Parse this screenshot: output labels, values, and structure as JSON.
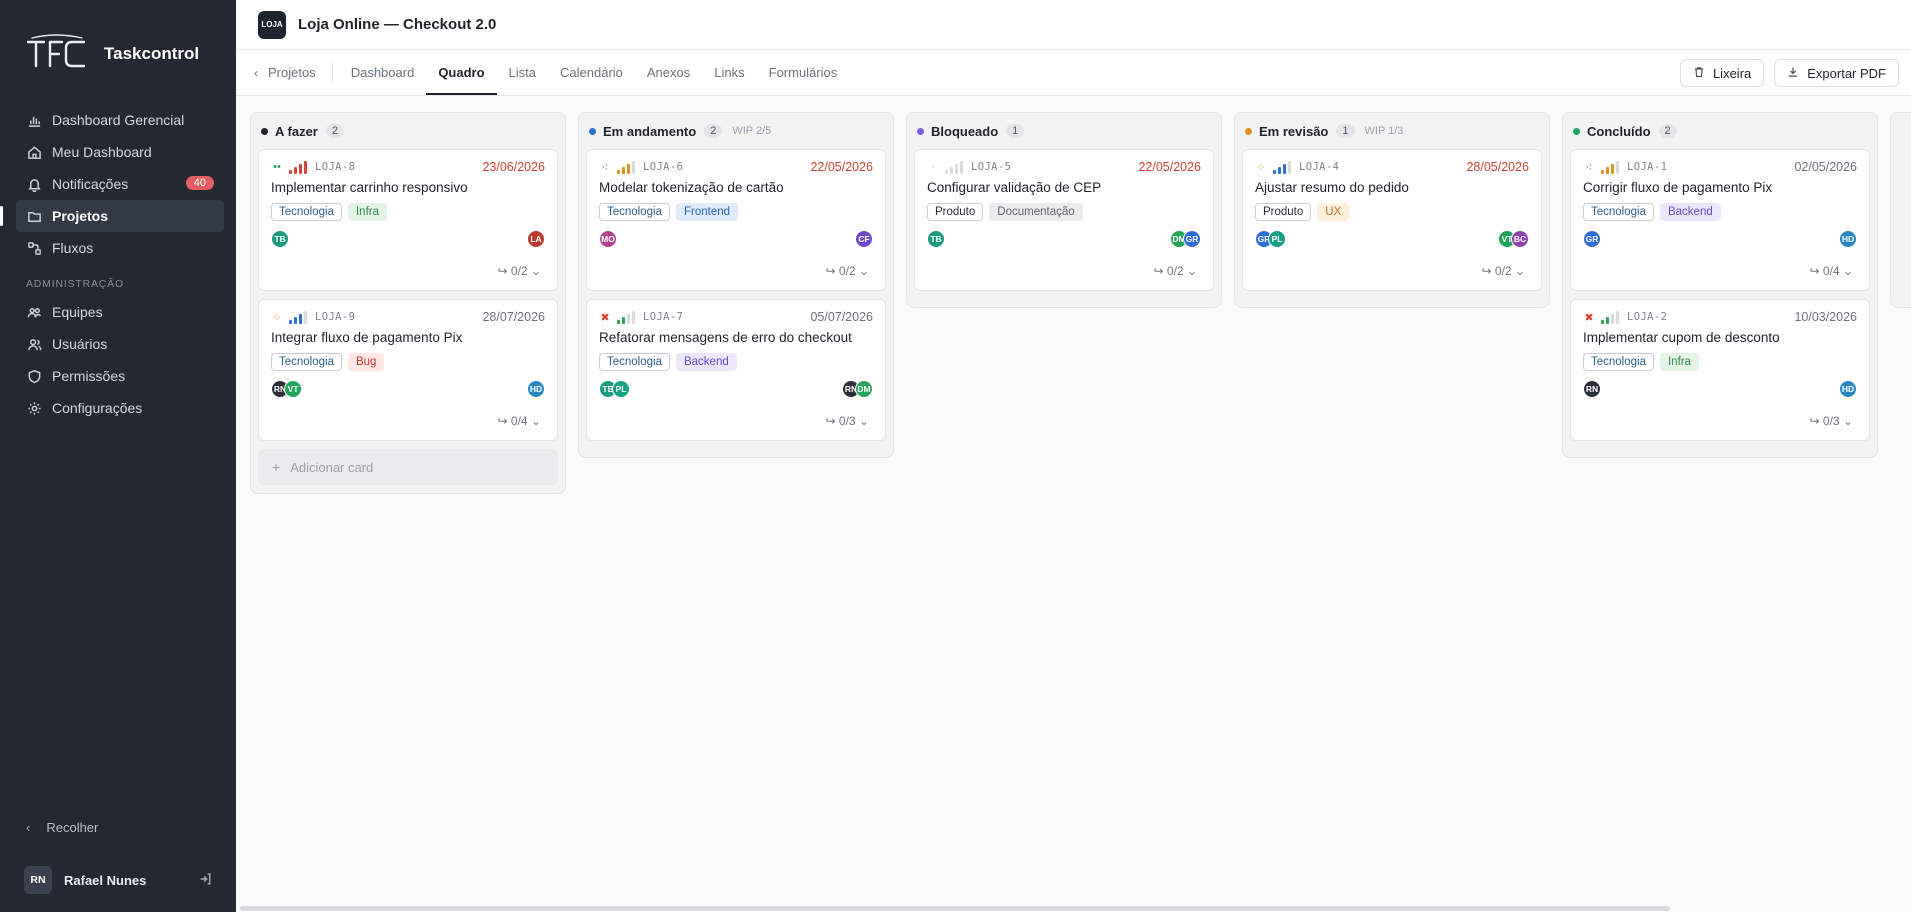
{
  "app": {
    "name": "Taskcontrol",
    "logo_text": "TFC"
  },
  "sidebar": {
    "items": [
      {
        "label": "Dashboard Gerencial",
        "icon": "bar-chart-icon"
      },
      {
        "label": "Meu Dashboard",
        "icon": "home-icon"
      },
      {
        "label": "Notificações",
        "icon": "bell-icon",
        "badge": "40"
      },
      {
        "label": "Projetos",
        "icon": "folder-icon",
        "active": true
      },
      {
        "label": "Fluxos",
        "icon": "flow-icon"
      }
    ],
    "section_label": "ADMINISTRAÇÃO",
    "admin_items": [
      {
        "label": "Equipes",
        "icon": "team-icon"
      },
      {
        "label": "Usuários",
        "icon": "users-icon"
      },
      {
        "label": "Permissões",
        "icon": "shield-icon"
      },
      {
        "label": "Configurações",
        "icon": "gear-icon"
      }
    ],
    "collapse_label": "Recolher",
    "user": {
      "initials": "RN",
      "name": "Rafael Nunes"
    }
  },
  "project": {
    "logo_text": "LOJA",
    "title": "Loja Online — Checkout 2.0"
  },
  "tabs": {
    "back_label": "Projetos",
    "items": [
      "Dashboard",
      "Quadro",
      "Lista",
      "Calendário",
      "Anexos",
      "Links",
      "Formulários"
    ],
    "active": "Quadro",
    "trash_label": "Lixeira",
    "export_label": "Exportar PDF"
  },
  "colors": {
    "tecnologia": "#2d5f8a",
    "infra_bg": "#e3f4e7",
    "infra_fg": "#2f8a4b",
    "bug_bg": "#fde6e4",
    "bug_fg": "#c23b32",
    "frontend_bg": "#e0ecfb",
    "frontend_fg": "#2464b8",
    "backend_bg": "#ece6fb",
    "backend_fg": "#6a4bc9",
    "doc_bg": "#ececee",
    "doc_fg": "#5f6470",
    "ux_bg": "#fdefdc",
    "ux_fg": "#c6741e",
    "overdue": "#c8442f",
    "normal_date": "#6b7280"
  },
  "board": {
    "columns": [
      {
        "title": "A fazer",
        "count": "2",
        "wip": "",
        "dot": "#1f2328",
        "cards": [
          {
            "key": "LOJA-8",
            "date": "23/06/2026",
            "overdue": true,
            "priority": "low",
            "bars": 4,
            "bar_color": "#d8433a",
            "title": "Implementar carrinho responsivo",
            "tags": [
              {
                "label": "Tecnologia",
                "kind": "outline"
              },
              {
                "label": "Infra",
                "kind": "infra"
              }
            ],
            "left_avatars": [
              {
                "initials": "TB",
                "color": "#1c9a7d"
              }
            ],
            "right_avatars": [
              {
                "initials": "LA",
                "color": "#c0392b"
              }
            ],
            "subtasks": "0/2"
          },
          {
            "key": "LOJA-9",
            "date": "28/07/2026",
            "overdue": false,
            "priority": "high",
            "bars": 3,
            "bar_color": "#2f6fd6",
            "title": "Integrar fluxo de pagamento Pix",
            "tags": [
              {
                "label": "Tecnologia",
                "kind": "outline"
              },
              {
                "label": "Bug",
                "kind": "bug"
              }
            ],
            "left_avatars": [
              {
                "initials": "RN",
                "color": "#2b2f3a"
              },
              {
                "initials": "VT",
                "color": "#1fa35a"
              }
            ],
            "right_avatars": [
              {
                "initials": "HD",
                "color": "#2e86c1"
              }
            ],
            "subtasks": "0/4"
          }
        ],
        "add_label": "Adicionar card"
      },
      {
        "title": "Em andamento",
        "count": "2",
        "wip": "WIP 2/5",
        "dot": "#2f6fd6",
        "cards": [
          {
            "key": "LOJA-6",
            "date": "22/05/2026",
            "overdue": true,
            "priority": "medium",
            "bars": 3,
            "bar_color": "#e0901f",
            "title": "Modelar tokenização de cartão",
            "tags": [
              {
                "label": "Tecnologia",
                "kind": "outline"
              },
              {
                "label": "Frontend",
                "kind": "frontend"
              }
            ],
            "left_avatars": [
              {
                "initials": "MO",
                "color": "#b0428f"
              }
            ],
            "right_avatars": [
              {
                "initials": "CF",
                "color": "#6a4bc9"
              }
            ],
            "subtasks": "0/2"
          },
          {
            "key": "LOJA-7",
            "date": "05/07/2026",
            "overdue": false,
            "priority": "urgent",
            "bars": 2,
            "bar_color": "#2fa35a",
            "title": "Refatorar mensagens de erro do checkout",
            "tags": [
              {
                "label": "Tecnologia",
                "kind": "outline"
              },
              {
                "label": "Backend",
                "kind": "backend"
              }
            ],
            "left_avatars": [
              {
                "initials": "TB",
                "color": "#1c9a7d"
              },
              {
                "initials": "PL",
                "color": "#16a085"
              }
            ],
            "right_avatars": [
              {
                "initials": "RN",
                "color": "#2b2f3a"
              },
              {
                "initials": "DM",
                "color": "#27a35a"
              }
            ],
            "subtasks": "0/3"
          }
        ]
      },
      {
        "title": "Bloqueado",
        "count": "1",
        "wip": "",
        "dot": "#7a5ce0",
        "cards": [
          {
            "key": "LOJA-5",
            "date": "22/05/2026",
            "overdue": true,
            "priority": "none",
            "bars": 0,
            "bar_color": "#d9dbe0",
            "title": "Configurar validação de CEP",
            "tags": [
              {
                "label": "Produto",
                "kind": "outline-dark"
              },
              {
                "label": "Documentação",
                "kind": "doc"
              }
            ],
            "left_avatars": [
              {
                "initials": "TB",
                "color": "#1c9a7d"
              }
            ],
            "right_avatars": [
              {
                "initials": "DM",
                "color": "#27a35a"
              },
              {
                "initials": "GR",
                "color": "#2e6fd1"
              }
            ],
            "subtasks": "0/2"
          }
        ]
      },
      {
        "title": "Em revisão",
        "count": "1",
        "wip": "WIP 1/3",
        "dot": "#e0901f",
        "cards": [
          {
            "key": "LOJA-4",
            "date": "28/05/2026",
            "overdue": true,
            "priority": "high",
            "bars": 3,
            "bar_color": "#2f6fd6",
            "title": "Ajustar resumo do pedido",
            "tags": [
              {
                "label": "Produto",
                "kind": "outline-dark"
              },
              {
                "label": "UX",
                "kind": "ux"
              }
            ],
            "left_avatars": [
              {
                "initials": "GR",
                "color": "#2e6fd1"
              },
              {
                "initials": "PL",
                "color": "#16a085"
              }
            ],
            "right_avatars": [
              {
                "initials": "VT",
                "color": "#1fa35a"
              },
              {
                "initials": "BC",
                "color": "#8e44ad"
              }
            ],
            "subtasks": "0/2"
          }
        ]
      },
      {
        "title": "Concluído",
        "count": "2",
        "wip": "",
        "dot": "#1fa35a",
        "cards": [
          {
            "key": "LOJA-1",
            "date": "02/05/2026",
            "overdue": false,
            "priority": "medium",
            "bars": 3,
            "bar_color": "#e0901f",
            "title": "Corrigir fluxo de pagamento Pix",
            "tags": [
              {
                "label": "Tecnologia",
                "kind": "outline"
              },
              {
                "label": "Backend",
                "kind": "backend"
              }
            ],
            "left_avatars": [
              {
                "initials": "GR",
                "color": "#2e6fd1"
              }
            ],
            "right_avatars": [
              {
                "initials": "HD",
                "color": "#2e86c1"
              }
            ],
            "subtasks": "0/4"
          },
          {
            "key": "LOJA-2",
            "date": "10/03/2026",
            "overdue": false,
            "priority": "urgent",
            "bars": 2,
            "bar_color": "#2fa35a",
            "title": "Implementar cupom de desconto",
            "tags": [
              {
                "label": "Tecnologia",
                "kind": "outline"
              },
              {
                "label": "Infra",
                "kind": "infra"
              }
            ],
            "left_avatars": [
              {
                "initials": "RN",
                "color": "#2b2f3a"
              }
            ],
            "right_avatars": [
              {
                "initials": "HD",
                "color": "#2e86c1"
              }
            ],
            "subtasks": "0/3"
          }
        ]
      }
    ]
  }
}
